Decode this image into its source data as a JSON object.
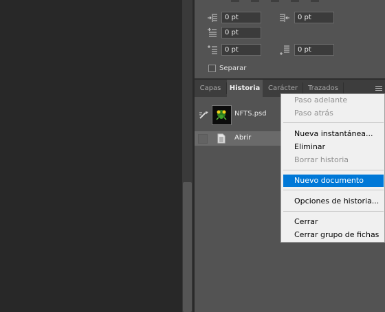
{
  "paragraph_panel": {
    "indent_left": "0 pt",
    "indent_right": "0 pt",
    "indent_first_line": "0 pt",
    "space_before": "0 pt",
    "space_after": "0 pt",
    "hyphenate_label": "Separar",
    "hyphenate_checked": false
  },
  "tabs": [
    {
      "label": "Capas",
      "active": false
    },
    {
      "label": "Historia",
      "active": true
    },
    {
      "label": "Carácter",
      "active": false
    },
    {
      "label": "Trazados",
      "active": false
    }
  ],
  "history": {
    "snapshot_name": "NFTS.psd",
    "state_label": "Abrir"
  },
  "context_menu": {
    "items": [
      {
        "label": "Paso adelante",
        "enabled": false
      },
      {
        "label": "Paso atrás",
        "enabled": false
      },
      {
        "label": "Nueva instantánea...",
        "enabled": true
      },
      {
        "label": "Eliminar",
        "enabled": true
      },
      {
        "label": "Borrar historia",
        "enabled": false
      },
      {
        "label": "Nuevo documento",
        "enabled": true,
        "highlighted": true
      },
      {
        "label": "Opciones de historia...",
        "enabled": true
      },
      {
        "label": "Cerrar",
        "enabled": true
      },
      {
        "label": "Cerrar grupo de fichas",
        "enabled": true
      }
    ]
  },
  "icons": {
    "indent_left": "indent-left-icon",
    "indent_right": "indent-right-icon",
    "indent_first_line": "indent-first-line-icon",
    "space_before": "space-before-icon",
    "space_after": "space-after-icon",
    "panel_menu": "panel-menu-icon",
    "snapshot_source": "history-brush-icon",
    "state": "document-icon"
  },
  "colors": {
    "menu_highlight": "#0078d7",
    "panel_bg": "#535353",
    "canvas_bg": "#282828"
  }
}
